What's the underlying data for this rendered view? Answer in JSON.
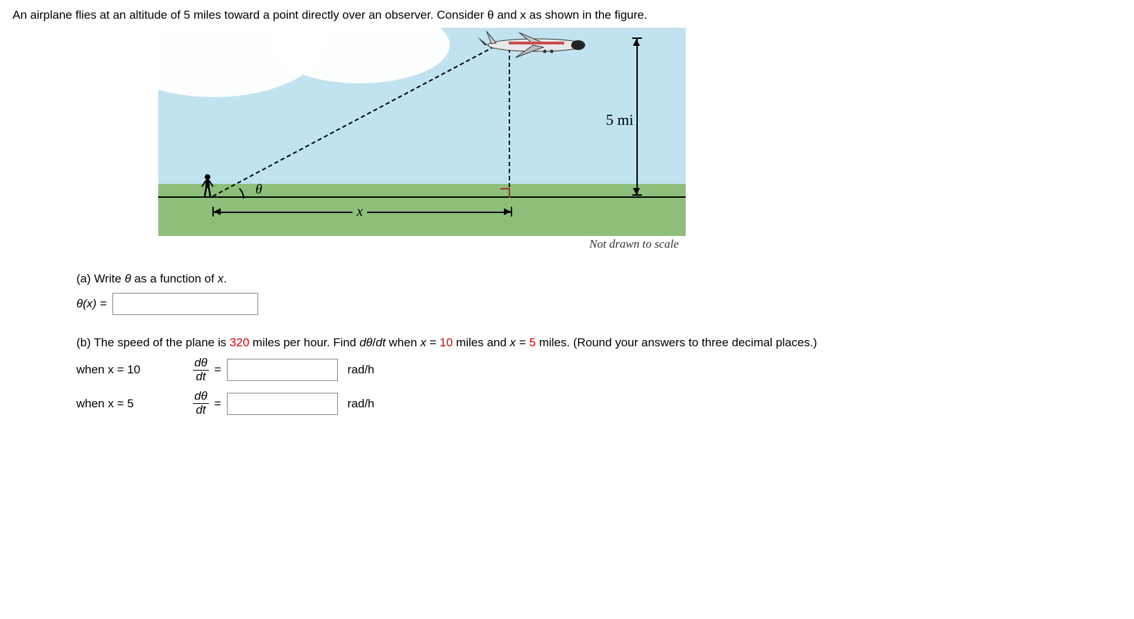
{
  "problem_intro": "An airplane flies at an altitude of 5 miles toward a point directly over an observer. Consider θ and x as shown in the figure.",
  "figure": {
    "altitude_label": "5 mi",
    "x_label": "x",
    "theta_label": "θ",
    "caption": "Not drawn to scale"
  },
  "part_a": {
    "prompt": "(a) Write θ as a function of x.",
    "lhs": "θ(x) =",
    "value": ""
  },
  "part_b": {
    "prompt_before_speed": "(b) The speed of the plane is ",
    "speed": "320",
    "prompt_after_speed": " miles per hour. Find dθ/dt when x = ",
    "x1": "10",
    "between": " miles and x = ",
    "x2": "5",
    "prompt_end": " miles. (Round your answers to three decimal places.)",
    "rows": [
      {
        "when": "when x = 10",
        "value": "",
        "unit": "rad/h"
      },
      {
        "when": "when x = 5",
        "value": "",
        "unit": "rad/h"
      }
    ],
    "deriv_num": "dθ",
    "deriv_den": "dt"
  }
}
